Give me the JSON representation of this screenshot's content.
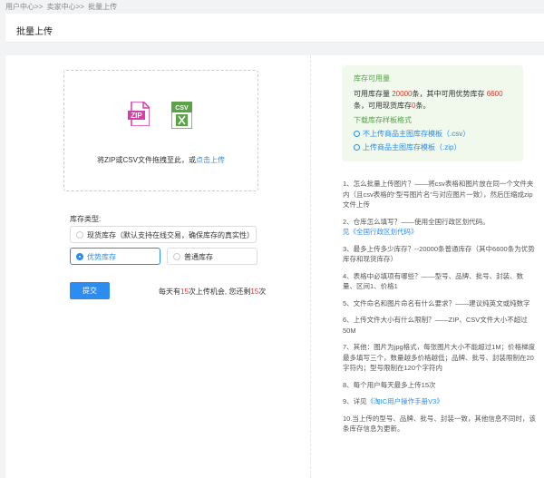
{
  "breadcrumb": [
    "用户中心>>",
    "卖家中心>>",
    "批量上传"
  ],
  "page_title": "批量上传",
  "upload": {
    "zip_icon_text": "ZIP",
    "csv_icon_text": "CSV",
    "hint": "将ZIP或CSV文件拖拽至此，或",
    "link": "点击上传"
  },
  "inventory": {
    "label": "库存类型:",
    "options": [
      {
        "label": "现货库存（默认支持在线交易，确保库存的真实性）",
        "selected": false
      },
      {
        "label": "优势库存",
        "selected": true
      },
      {
        "label": "普通库存",
        "selected": false
      }
    ]
  },
  "submit_label": "提交",
  "quota": {
    "prefix": "每天有",
    "total": "15",
    "mid": "次上传机会, 您还剩",
    "remain": "15",
    "suffix": "次"
  },
  "stock_box": {
    "title": "库存可用量",
    "line1_a": "可用库存量 ",
    "line1_num": "20000",
    "line1_b": "条，其中可用优势库存 ",
    "line1_num2": "6600",
    "line2_a": "条，可用现货库存",
    "line2_num": "0",
    "line2_b": "条。",
    "template_title": "下载库存样板格式",
    "link1": "不上传商品主图库存模板（.csv）",
    "link2": "上传商品主图库存模板（.zip）"
  },
  "faq": [
    "1、怎么批量上传图片？——将csv表格和图片放在同一个文件夹内（且csv表格的“型号图片名”与对应图片一致），然后压缩成zip文件上传",
    "2、仓库怎么填写？——使用全国行政区划代码。",
    "3、最多上传多少库存？--20000条普通库存（其中6600条为优势库存和现货库存）",
    "4、表格中必填项有哪些？——型号、品牌、批号、封装、数量、区间1、价格1",
    "5、文件命名和图片命名有什么要求？——建议纯英文或纯数字",
    "6、上传文件大小有什么限制？——ZIP、CSV文件大小不超过50M",
    "7、其他：图片为jpg格式，每张图片大小不能超过1M；价格梯度最多填写三个，数量越多价格越低；品牌、批号、封装限制在20字符内；型号限制在120个字符内",
    "8、每个用户每天最多上传15次",
    "9、详见",
    "10.当上传的型号、品牌、批号、封装一致，其他信息不同时，该条库存信息为更新。"
  ],
  "faq_links": {
    "region": "见《全国行政区划代码》",
    "manual": "《淘IC用户操作手册V3》"
  }
}
